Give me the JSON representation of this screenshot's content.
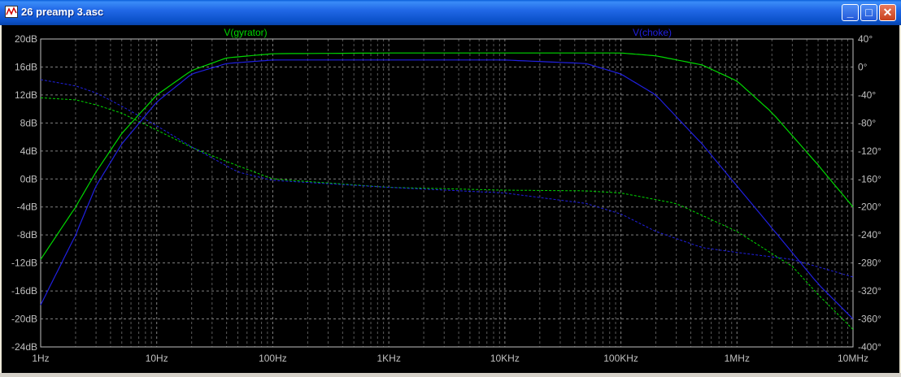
{
  "window": {
    "title": "26 preamp 3.asc",
    "min_label": "_",
    "max_label": "□",
    "close_label": "✕"
  },
  "colors": {
    "background": "#000000",
    "axis_text": "#c0c0c0",
    "grid": "#808080",
    "gyrator": "#00d800",
    "choke": "#2020e0"
  },
  "chart_data": {
    "type": "line",
    "x_scale": "log",
    "xlim": [
      1,
      10000000
    ],
    "x_ticks": [
      {
        "value": 1,
        "label": "1Hz"
      },
      {
        "value": 10,
        "label": "10Hz"
      },
      {
        "value": 100,
        "label": "100Hz"
      },
      {
        "value": 1000,
        "label": "1KHz"
      },
      {
        "value": 10000,
        "label": "10KHz"
      },
      {
        "value": 100000,
        "label": "100KHz"
      },
      {
        "value": 1000000,
        "label": "1MHz"
      },
      {
        "value": 10000000,
        "label": "10MHz"
      }
    ],
    "y_left": {
      "unit": "dB",
      "lim": [
        -24,
        20
      ],
      "ticks": [
        {
          "value": 20,
          "label": "20dB"
        },
        {
          "value": 16,
          "label": "16dB"
        },
        {
          "value": 12,
          "label": "12dB"
        },
        {
          "value": 8,
          "label": "8dB"
        },
        {
          "value": 4,
          "label": "4dB"
        },
        {
          "value": 0,
          "label": "0dB"
        },
        {
          "value": -4,
          "label": "-4dB"
        },
        {
          "value": -8,
          "label": "-8dB"
        },
        {
          "value": -12,
          "label": "-12dB"
        },
        {
          "value": -16,
          "label": "-16dB"
        },
        {
          "value": -20,
          "label": "-20dB"
        },
        {
          "value": -24,
          "label": "-24dB"
        }
      ]
    },
    "y_right": {
      "unit": "deg",
      "lim": [
        -400,
        40
      ],
      "ticks": [
        {
          "value": 40,
          "label": "40°"
        },
        {
          "value": 0,
          "label": "0°"
        },
        {
          "value": -40,
          "label": "-40°"
        },
        {
          "value": -80,
          "label": "-80°"
        },
        {
          "value": -120,
          "label": "-120°"
        },
        {
          "value": -160,
          "label": "-160°"
        },
        {
          "value": -200,
          "label": "-200°"
        },
        {
          "value": -240,
          "label": "-240°"
        },
        {
          "value": -280,
          "label": "-280°"
        },
        {
          "value": -320,
          "label": "-320°"
        },
        {
          "value": -360,
          "label": "-360°"
        },
        {
          "value": -400,
          "label": "-400°"
        }
      ]
    },
    "grid": true,
    "series": [
      {
        "name": "V(gyrator)",
        "color": "#00d800",
        "magnitude": [
          [
            1,
            -11.5
          ],
          [
            2,
            -4
          ],
          [
            3,
            1
          ],
          [
            5,
            6.5
          ],
          [
            10,
            12
          ],
          [
            20,
            15.5
          ],
          [
            40,
            17.3
          ],
          [
            100,
            17.9
          ],
          [
            1000,
            18
          ],
          [
            10000,
            18
          ],
          [
            100000,
            18
          ],
          [
            200000,
            17.6
          ],
          [
            500000,
            16.3
          ],
          [
            1000000,
            14
          ],
          [
            2000000,
            9.5
          ],
          [
            5000000,
            2
          ],
          [
            10000000,
            -4
          ]
        ],
        "phase": [
          [
            1,
            -44
          ],
          [
            2,
            -47
          ],
          [
            3,
            -54
          ],
          [
            5,
            -66
          ],
          [
            10,
            -90
          ],
          [
            20,
            -115
          ],
          [
            40,
            -135
          ],
          [
            100,
            -160
          ],
          [
            1000,
            -172
          ],
          [
            10000,
            -176
          ],
          [
            50000,
            -177
          ],
          [
            100000,
            -180
          ],
          [
            300000,
            -195
          ],
          [
            1000000,
            -235
          ],
          [
            3000000,
            -285
          ],
          [
            5000000,
            -325
          ],
          [
            10000000,
            -375
          ]
        ]
      },
      {
        "name": "V(choke)",
        "color": "#2020e0",
        "magnitude": [
          [
            1,
            -18
          ],
          [
            2,
            -8
          ],
          [
            3,
            -1
          ],
          [
            5,
            5
          ],
          [
            10,
            11
          ],
          [
            20,
            15
          ],
          [
            40,
            16.5
          ],
          [
            100,
            17
          ],
          [
            1000,
            17
          ],
          [
            10000,
            17
          ],
          [
            50000,
            16.5
          ],
          [
            100000,
            15
          ],
          [
            200000,
            12
          ],
          [
            500000,
            5
          ],
          [
            1000000,
            -1
          ],
          [
            2000000,
            -7
          ],
          [
            5000000,
            -15
          ],
          [
            10000000,
            -20
          ]
        ],
        "phase": [
          [
            1,
            -18
          ],
          [
            2,
            -27
          ],
          [
            3,
            -37
          ],
          [
            5,
            -56
          ],
          [
            10,
            -84
          ],
          [
            20,
            -114
          ],
          [
            50,
            -150
          ],
          [
            100,
            -162
          ],
          [
            1000,
            -172
          ],
          [
            10000,
            -180
          ],
          [
            50000,
            -195
          ],
          [
            100000,
            -210
          ],
          [
            200000,
            -235
          ],
          [
            500000,
            -258
          ],
          [
            1000000,
            -265
          ],
          [
            3000000,
            -275
          ],
          [
            10000000,
            -300
          ]
        ]
      }
    ]
  }
}
